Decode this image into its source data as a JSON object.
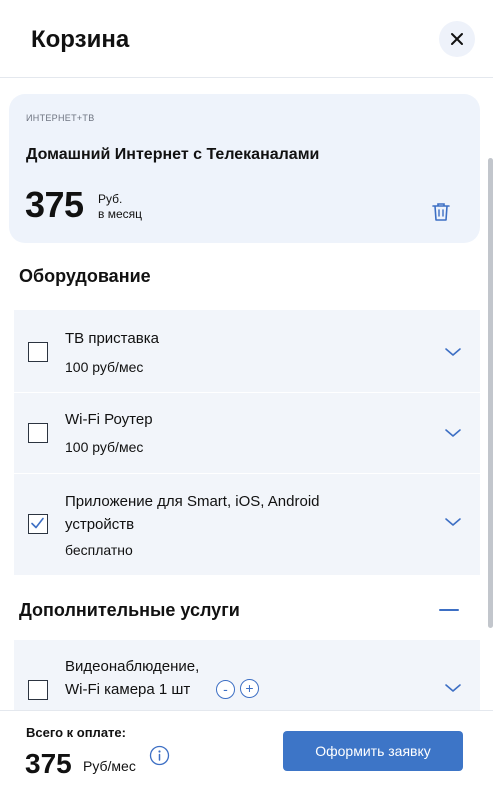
{
  "header": {
    "title": "Корзина",
    "close_icon": "close-icon"
  },
  "tariff": {
    "category": "ИНТЕРНЕТ+ТВ",
    "name": "Домашний Интернет с Телеканалами",
    "price": "375",
    "currency": "Руб.",
    "period": "в месяц",
    "delete_icon": "trash-icon"
  },
  "equipment": {
    "title": "Оборудование",
    "items": [
      {
        "name": "ТВ приставка",
        "price": "100 руб/мес",
        "checked": false
      },
      {
        "name": "Wi-Fi Роутер",
        "price": "100 руб/мес",
        "checked": false
      },
      {
        "name_line1": "Приложение для Smart, iOS, Android",
        "name_line2": "устройств",
        "price": "бесплатно",
        "checked": true
      }
    ]
  },
  "services": {
    "title": "Дополнительные услуги",
    "collapse_icon": "minus-icon",
    "items": [
      {
        "name_line1": "Видеонаблюдение,",
        "name_line2": "Wi-Fi камера 1 шт",
        "minus_label": "-",
        "plus_label": "+",
        "checked": false
      }
    ]
  },
  "footer": {
    "total_label": "Всего к оплате:",
    "total_price": "375",
    "total_unit": "Руб/мес",
    "info_icon": "info-icon",
    "submit_label": "Оформить заявку"
  },
  "colors": {
    "accent": "#3d75c7",
    "card_background": "#eef3fb",
    "list_background": "#f2f5fa",
    "text": "#111111"
  }
}
